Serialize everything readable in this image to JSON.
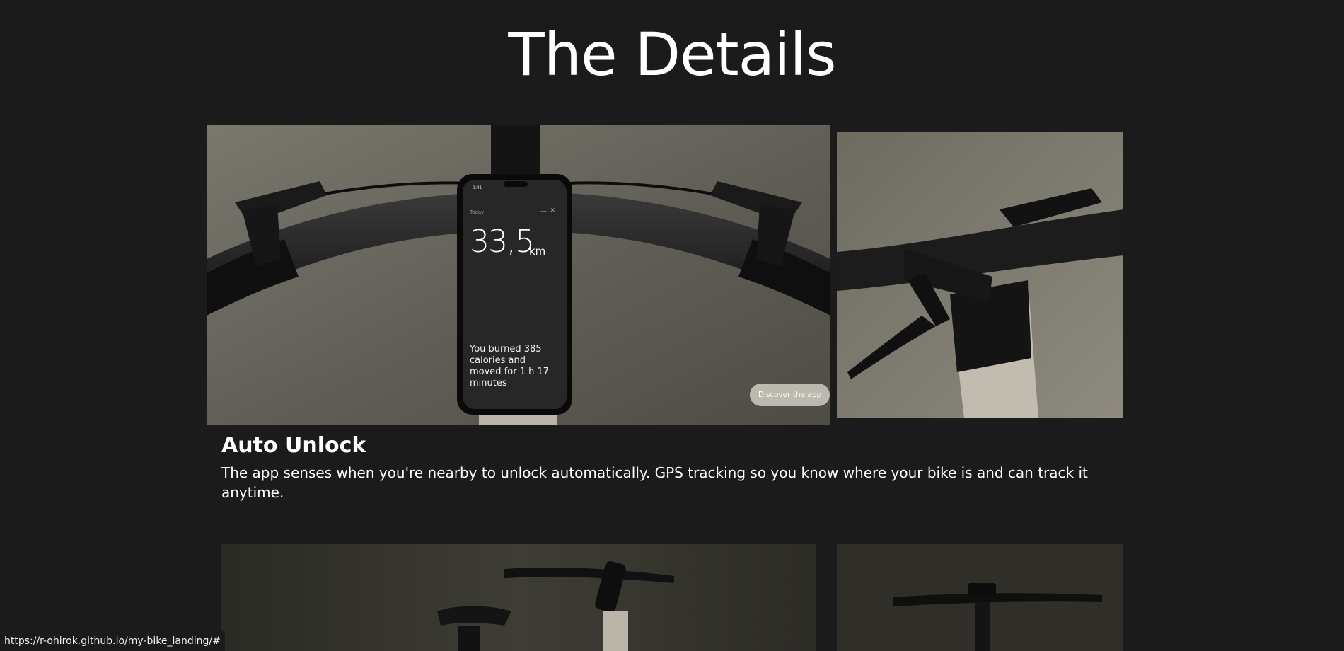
{
  "details": {
    "title": "The Details"
  },
  "feature": {
    "title": "Auto Unlock",
    "description": "The app senses when you're nearby to unlock automatically. GPS tracking so you know where your bike is and can track it anytime."
  },
  "phone_app": {
    "time": "9:41",
    "today_label": "Today",
    "distance": "33,5",
    "distance_unit": "km",
    "summary": "You burned 385 calories and moved for 1 h 17 minutes",
    "minimize_icon": "minus-icon",
    "close_icon": "close-icon"
  },
  "discover_button": {
    "label": "Discover the app"
  },
  "status_bar": {
    "url": "https://r-ohirok.github.io/my-bike_landing/#"
  },
  "colors": {
    "background": "#1b1b1b",
    "photo_background": "#6c6a60",
    "button_background": "#bdb9af",
    "text": "#ffffff"
  }
}
